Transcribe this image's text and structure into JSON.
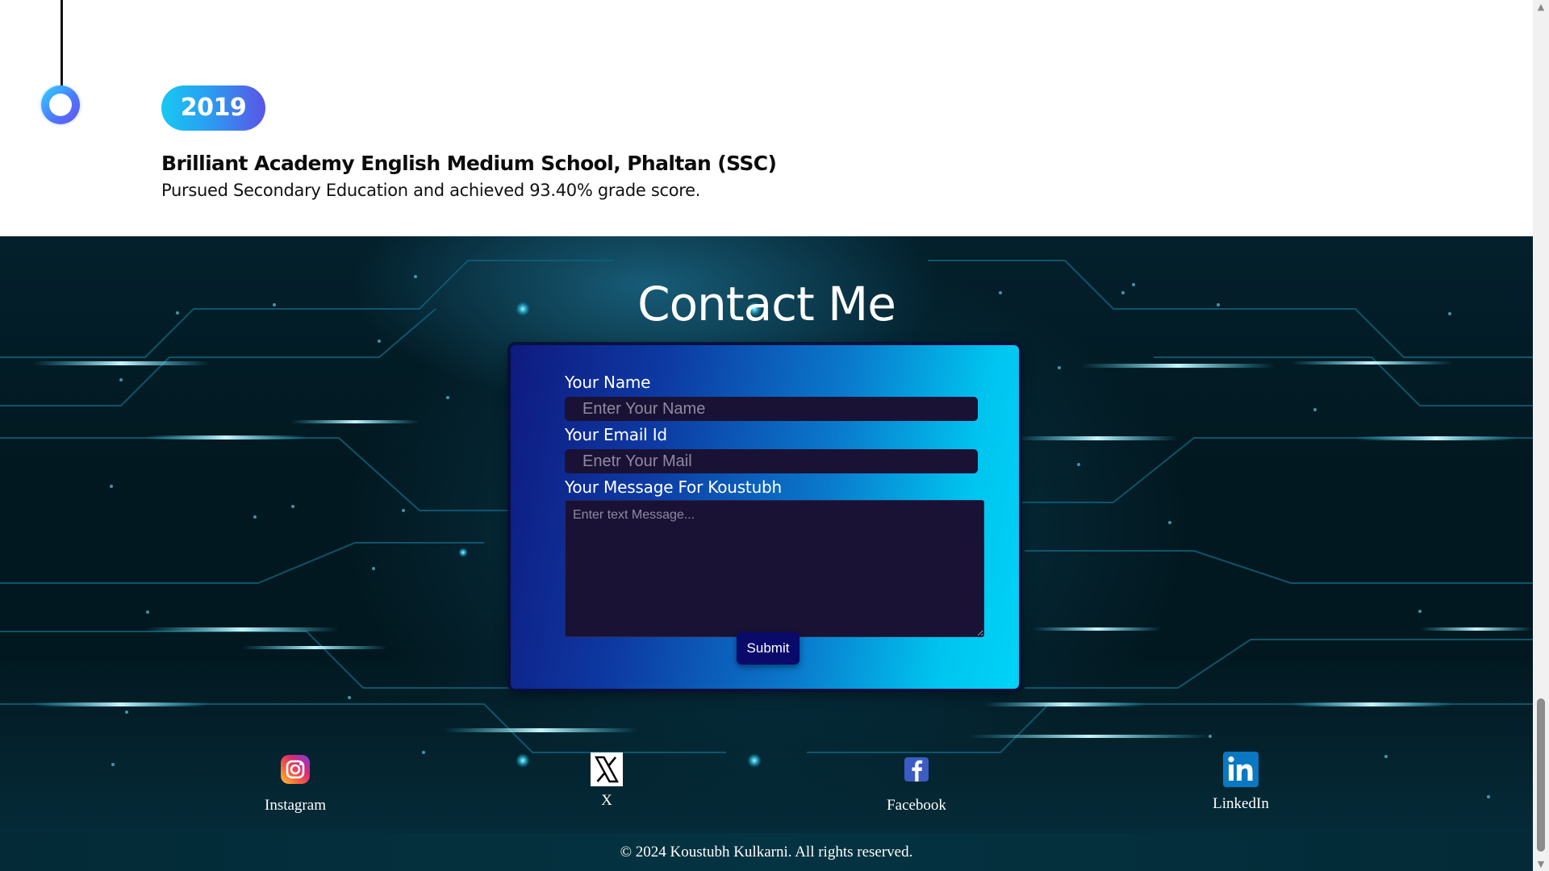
{
  "timeline": {
    "year": "2019",
    "title": "Brilliant Academy English Medium School, Phaltan (SSC)",
    "description": "Pursued Secondary Education and achieved 93.40% grade score."
  },
  "contact": {
    "heading": "Contact Me",
    "name_label": "Your Name",
    "name_placeholder": "Enter Your Name",
    "email_label": "Your Email Id",
    "email_placeholder": "Enetr Your Mail",
    "message_label": "Your Message For Koustubh",
    "message_placeholder": "Enter text Message...",
    "submit_label": "Submit"
  },
  "social": [
    {
      "label": "Instagram",
      "icon": "instagram-icon"
    },
    {
      "label": "X",
      "icon": "x-icon"
    },
    {
      "label": "Facebook",
      "icon": "facebook-icon"
    },
    {
      "label": "LinkedIn",
      "icon": "linkedin-icon"
    }
  ],
  "footer": {
    "copyright": "© 2024 Koustubh Kulkarni. All rights reserved."
  },
  "colors": {
    "accent_cyan": "#18c8f2",
    "accent_purple": "#5a55e6",
    "form_dark": "#0f1a80",
    "form_light": "#00d3f8",
    "input_bg": "#1a1235",
    "button_bg": "#0a0a6b"
  }
}
